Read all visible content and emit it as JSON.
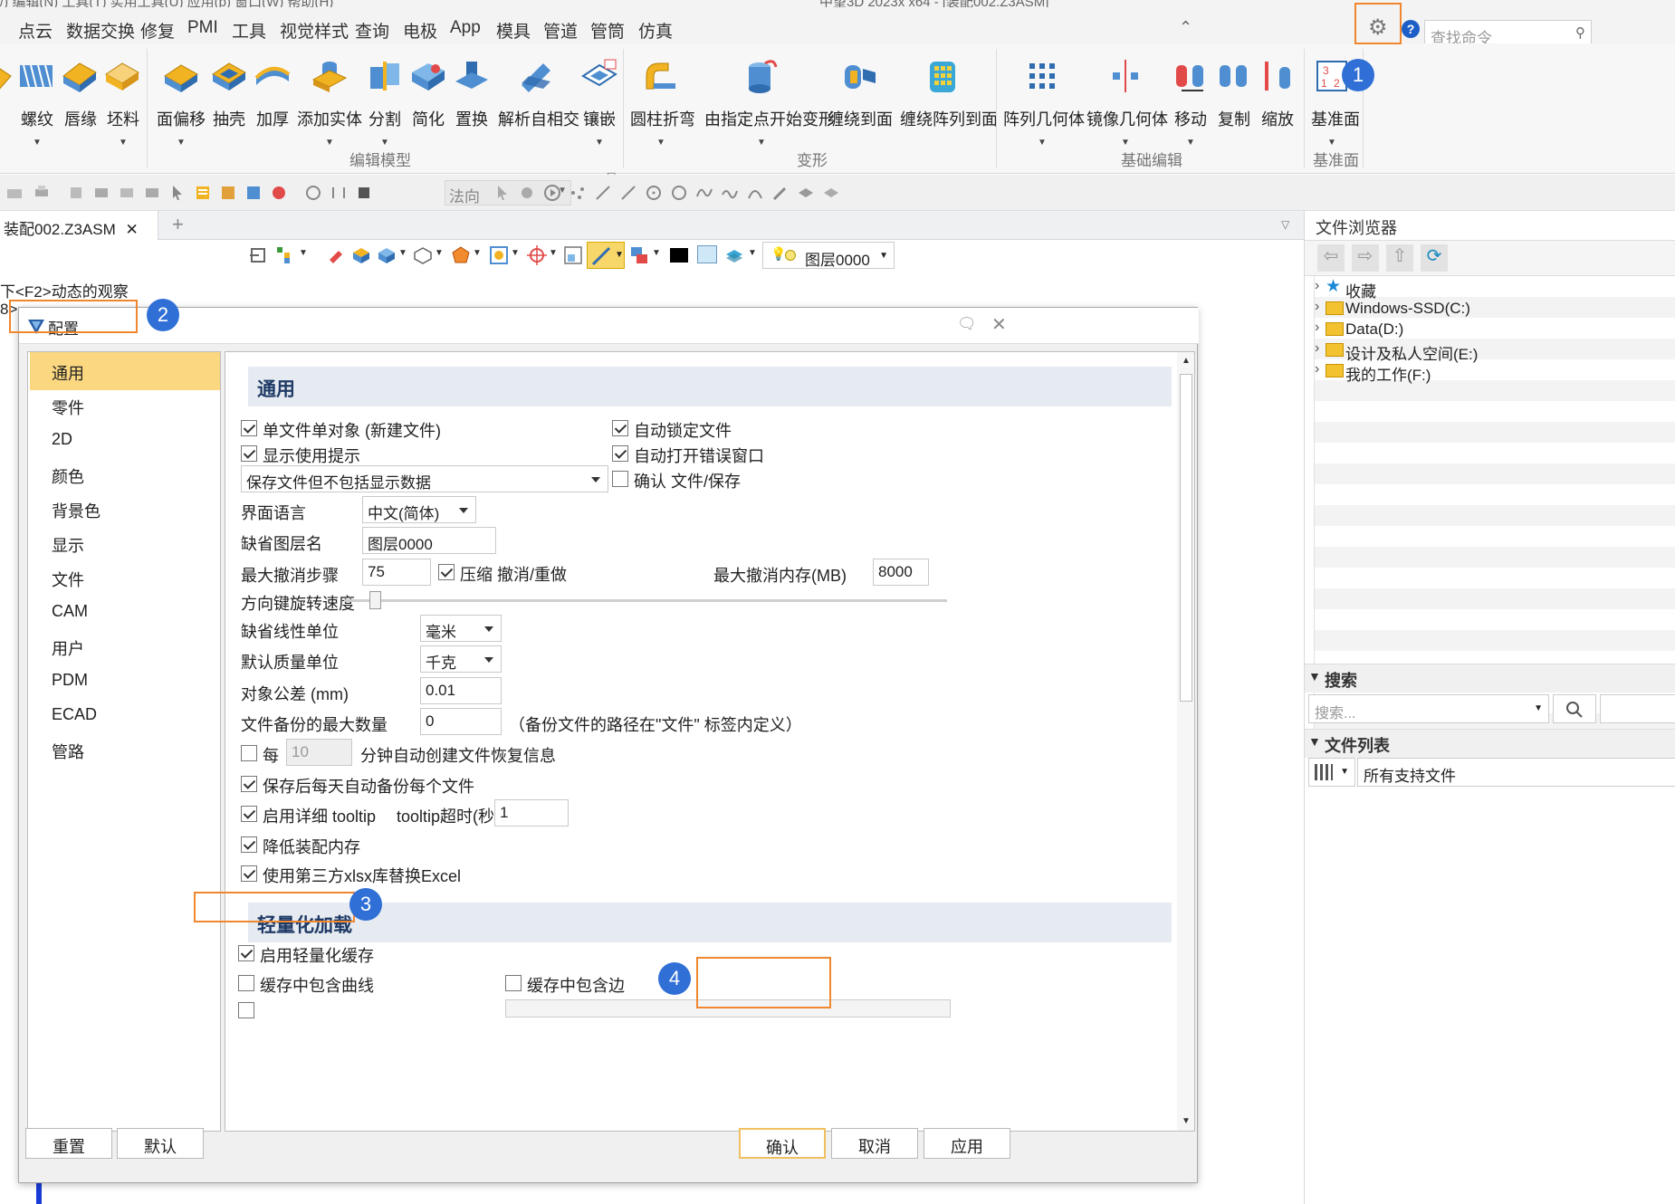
{
  "window": {
    "top_clip_left": "/) 编辑(N) 工具(T) 实用工具(U) 应用(p) 窗口(W) 帮助(H)",
    "top_clip_right": "中望3D 2023x x64 - [装配002.Z3ASM]"
  },
  "menubar": {
    "items": [
      "点云",
      "数据交换",
      "修复",
      "PMI",
      "工具",
      "视觉样式",
      "查询",
      "电极",
      "App",
      "模具",
      "管道",
      "管筒",
      "仿真"
    ],
    "search_placeholder": "查找命令"
  },
  "ribbon": {
    "buttons": [
      "螺纹",
      "唇缘",
      "坯料",
      "面偏移",
      "抽壳",
      "加厚",
      "添加实体",
      "分割",
      "简化",
      "置换",
      "解析自相交",
      "镶嵌",
      "圆柱折弯",
      "由指定点开始变形",
      "缠绕到面",
      "缠绕阵列到面",
      "阵列几何体",
      "镜像几何体",
      "移动",
      "复制",
      "缩放",
      "基准面"
    ],
    "groups": [
      "编辑模型",
      "变形",
      "基础编辑",
      "基准面"
    ]
  },
  "toolbar2": {
    "direction_placeholder": "法向"
  },
  "document": {
    "tab_title": "装配002.Z3ASM",
    "hint_line": "下<F2>动态的观察",
    "hint_line2": "8>"
  },
  "toolbar3": {
    "layer": "图层0000"
  },
  "file_browser": {
    "title": "文件浏览器",
    "tree": [
      "收藏",
      "Windows-SSD(C:)",
      "Data(D:)",
      "设计及私人空间(E:)",
      "我的工作(F:)"
    ],
    "search_title": "搜索",
    "search_placeholder": "搜索...",
    "file_list_title": "文件列表",
    "file_filter": "所有支持文件"
  },
  "dialog": {
    "title": "配置",
    "nav": [
      "通用",
      "零件",
      "2D",
      "颜色",
      "背景色",
      "显示",
      "文件",
      "CAM",
      "用户",
      "PDM",
      "ECAD",
      "管路"
    ],
    "section_general": "通用",
    "section_lightweight": "轻量化加载",
    "opts": {
      "single_file": "单文件单对象 (新建文件)",
      "show_tips": "显示使用提示",
      "auto_lock": "自动锁定文件",
      "auto_open_err": "自动打开错误窗口",
      "confirm_save": "确认 文件/保存",
      "save_mode": "保存文件但不包括显示数据",
      "ui_lang_label": "界面语言",
      "ui_lang": "中文(简体)",
      "default_layer_label": "缺省图层名",
      "default_layer": "图层0000",
      "max_undo_label": "最大撤消步骤",
      "max_undo": "75",
      "compress_undo": "压缩 撤消/重做",
      "max_undo_mem_label": "最大撤消内存(MB)",
      "max_undo_mem": "8000",
      "arrow_speed_label": "方向键旋转速度",
      "linear_unit_label": "缺省线性单位",
      "linear_unit": "毫米",
      "mass_unit_label": "默认质量单位",
      "mass_unit": "千克",
      "tolerance_label": "对象公差 (mm)",
      "tolerance": "0.01",
      "backup_label": "文件备份的最大数量",
      "backup": "0",
      "backup_note": "（备份文件的路径在\"文件\" 标签内定义）",
      "every": "每",
      "every_val": "10",
      "every_tail": "分钟自动创建文件恢复信息",
      "daily_backup": "保存后每天自动备份每个文件",
      "detail_tooltip": "启用详细 tooltip",
      "tooltip_timeout_label": "tooltip超时(秒)",
      "tooltip_timeout": "1",
      "reduce_mem": "降低装配内存",
      "xlsx": "使用第三方xlsx库替换Excel",
      "lw_cache": "启用轻量化缓存",
      "cache_curves": "缓存中包含曲线",
      "cache_edges": "缓存中包含边"
    },
    "buttons": {
      "reset": "重置",
      "default": "默认",
      "ok": "确认",
      "cancel": "取消",
      "apply": "应用"
    }
  },
  "annotations": {
    "b1": "1",
    "b2": "2",
    "b3": "3",
    "b4": "4",
    "color": "#f0872e",
    "badge_color": "#2f6fd6"
  }
}
